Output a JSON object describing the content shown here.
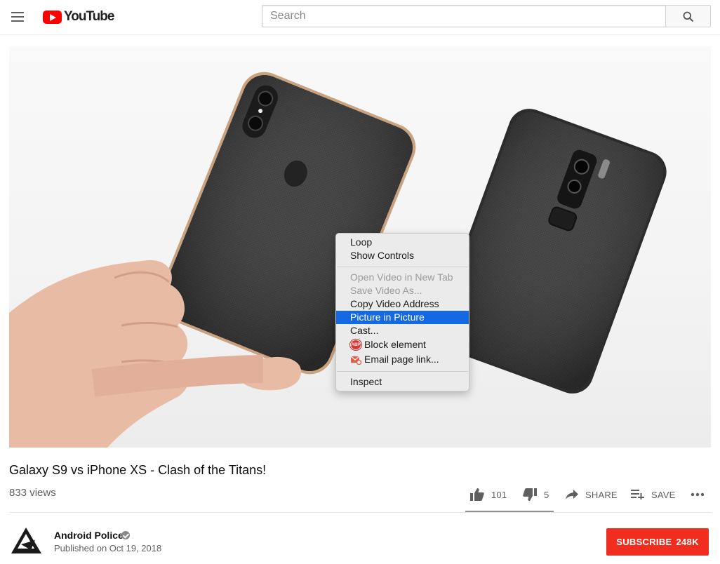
{
  "masthead": {
    "logo_text": "YouTube",
    "search_placeholder": "Search"
  },
  "context_menu": {
    "items": [
      {
        "label": "Loop",
        "enabled": true
      },
      {
        "label": "Show Controls",
        "enabled": true
      },
      {
        "label": "Open Video in New Tab",
        "enabled": false
      },
      {
        "label": "Save Video As...",
        "enabled": false
      },
      {
        "label": "Copy Video Address",
        "enabled": true
      },
      {
        "label": "Picture in Picture",
        "enabled": true,
        "highlighted": true
      },
      {
        "label": "Cast...",
        "enabled": true
      },
      {
        "label": "Block element",
        "enabled": true,
        "icon": "adblock-plus-icon",
        "icon_text": "ABP"
      },
      {
        "label": "Email page link...",
        "enabled": true,
        "icon": "email-icon"
      },
      {
        "label": "Inspect",
        "enabled": true
      }
    ]
  },
  "video": {
    "title": "Galaxy S9 vs iPhone XS - Clash of the Titans!",
    "views": "833 views",
    "likes": "101",
    "dislikes": "5",
    "like_ratio": 0.95,
    "share_label": "SHARE",
    "save_label": "SAVE"
  },
  "channel": {
    "name": "Android Police",
    "published": "Published on Oct 19, 2018",
    "subscribe_label": "SUBSCRIBE",
    "subscriber_count": "248K"
  },
  "colors": {
    "brand_red": "#ff0000",
    "subscribe_red": "#f12d1f",
    "menu_highlight": "#1469e2"
  }
}
